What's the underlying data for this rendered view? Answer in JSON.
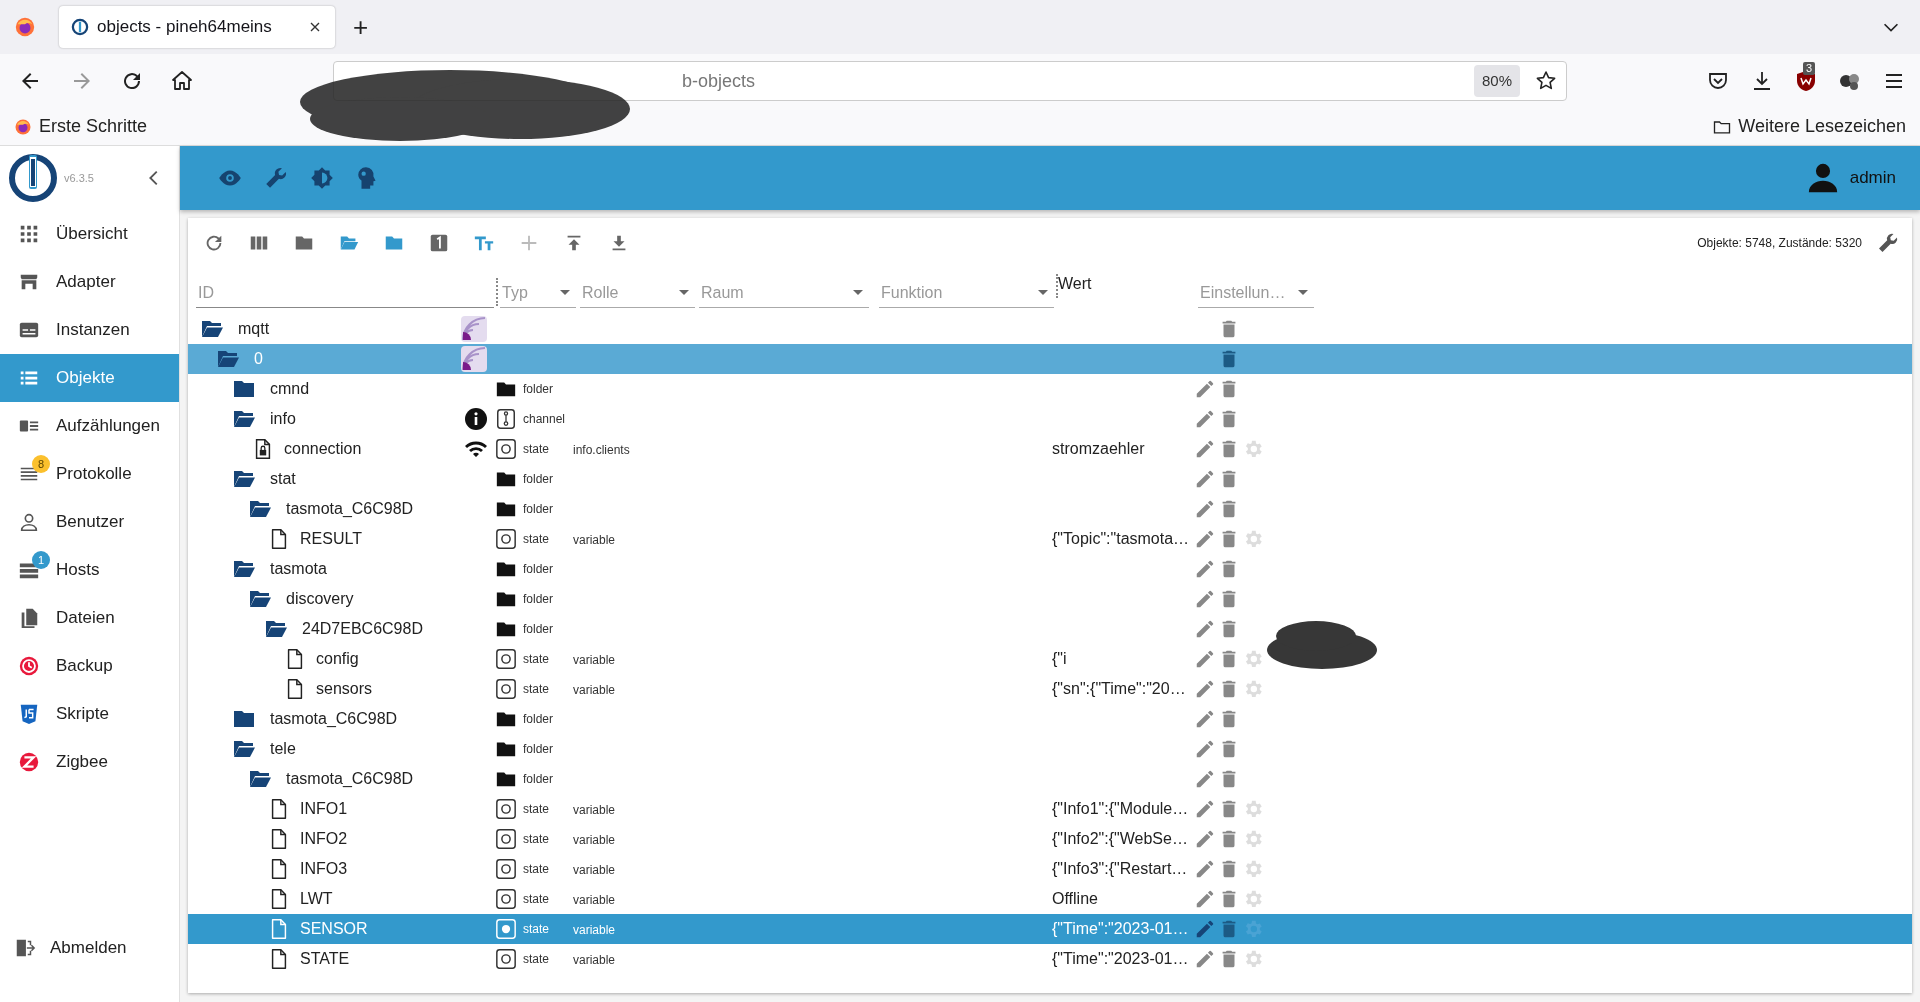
{
  "browser": {
    "tab_title": "objects - pineh64meins",
    "new_tab": "+",
    "url_visible": "b-objects",
    "zoom": "80%",
    "extension_badge": "3",
    "bookmarks": [
      "Erste Schritte"
    ],
    "other_bookmarks": "Weitere Lesezeichen"
  },
  "app": {
    "version": "v6.3.5",
    "user": "admin"
  },
  "sidebar": {
    "items": [
      {
        "label": "Übersicht",
        "selected": false
      },
      {
        "label": "Adapter",
        "selected": false
      },
      {
        "label": "Instanzen",
        "selected": false
      },
      {
        "label": "Objekte",
        "selected": true
      },
      {
        "label": "Aufzählungen",
        "selected": false
      },
      {
        "label": "Protokolle",
        "selected": false,
        "badge": "8",
        "color": "#fbc02d"
      },
      {
        "label": "Benutzer",
        "selected": false
      },
      {
        "label": "Hosts",
        "selected": false,
        "badge": "1",
        "color": "#3399cc"
      },
      {
        "label": "Dateien",
        "selected": false
      },
      {
        "label": "Backup",
        "selected": false
      },
      {
        "label": "Skripte",
        "selected": false
      },
      {
        "label": "Zigbee",
        "selected": false
      }
    ],
    "logout": "Abmelden"
  },
  "objects": {
    "stats": "Objekte: 5748, Zustände: 5320",
    "filters": {
      "id_placeholder": "ID",
      "typ": "Typ",
      "rolle": "Rolle",
      "raum": "Raum",
      "funktion": "Funktion",
      "wert": "Wert",
      "einstellungen": "Einstellun…"
    },
    "tree": [
      {
        "name": "mqtt",
        "kind": "adapter",
        "expanded": true,
        "selected": false,
        "highlighted": false,
        "children": [
          {
            "name": "0",
            "kind": "adapter",
            "expanded": true,
            "selected": false,
            "highlighted": true,
            "children": [
              {
                "name": "cmnd",
                "kind": "folder",
                "expanded": false,
                "type": "folder",
                "selected": false,
                "highlighted": false
              },
              {
                "name": "info",
                "kind": "channel",
                "expanded": true,
                "type": "channel",
                "selected": false,
                "highlighted": false,
                "children": [
                  {
                    "name": "connection",
                    "kind": "connection",
                    "type": "state",
                    "role": "info.clients",
                    "value": "stromzaehler",
                    "selected": false,
                    "highlighted": false
                  }
                ]
              },
              {
                "name": "stat",
                "kind": "folder",
                "expanded": true,
                "type": "folder",
                "selected": false,
                "highlighted": false,
                "children": [
                  {
                    "name": "tasmota_C6C98D",
                    "kind": "folder",
                    "expanded": true,
                    "type": "folder",
                    "selected": false,
                    "highlighted": false,
                    "children": [
                      {
                        "name": "RESULT",
                        "kind": "state",
                        "type": "state",
                        "role": "variable",
                        "value": "{\"Topic\":\"tasmota…",
                        "selected": false,
                        "highlighted": false
                      }
                    ]
                  }
                ]
              },
              {
                "name": "tasmota",
                "kind": "folder",
                "expanded": true,
                "type": "folder",
                "selected": false,
                "highlighted": false,
                "children": [
                  {
                    "name": "discovery",
                    "kind": "folder",
                    "expanded": true,
                    "type": "folder",
                    "selected": false,
                    "highlighted": false,
                    "children": [
                      {
                        "name": "24D7EBC6C98D",
                        "kind": "folder",
                        "expanded": true,
                        "type": "folder",
                        "selected": false,
                        "highlighted": false,
                        "children": [
                          {
                            "name": "config",
                            "kind": "state",
                            "type": "state",
                            "role": "variable",
                            "value": "{\"i",
                            "redacted": true,
                            "selected": false,
                            "highlighted": false
                          },
                          {
                            "name": "sensors",
                            "kind": "state",
                            "type": "state",
                            "role": "variable",
                            "value": "{\"sn\":{\"Time\":\"20…",
                            "selected": false,
                            "highlighted": false
                          }
                        ]
                      }
                    ]
                  }
                ]
              },
              {
                "name": "tasmota_C6C98D",
                "kind": "folder",
                "expanded": false,
                "type": "folder",
                "selected": false,
                "highlighted": false
              },
              {
                "name": "tele",
                "kind": "folder",
                "expanded": true,
                "type": "folder",
                "selected": false,
                "highlighted": false,
                "children": [
                  {
                    "name": "tasmota_C6C98D",
                    "kind": "folder",
                    "expanded": true,
                    "type": "folder",
                    "selected": false,
                    "highlighted": false,
                    "children": [
                      {
                        "name": "INFO1",
                        "kind": "state",
                        "type": "state",
                        "role": "variable",
                        "value": "{\"Info1\":{\"Module…",
                        "selected": false,
                        "highlighted": false
                      },
                      {
                        "name": "INFO2",
                        "kind": "state",
                        "type": "state",
                        "role": "variable",
                        "value": "{\"Info2\":{\"WebSe…",
                        "selected": false,
                        "highlighted": false
                      },
                      {
                        "name": "INFO3",
                        "kind": "state",
                        "type": "state",
                        "role": "variable",
                        "value": "{\"Info3\":{\"Restart…",
                        "selected": false,
                        "highlighted": false
                      },
                      {
                        "name": "LWT",
                        "kind": "state",
                        "type": "state",
                        "role": "variable",
                        "value": "Offline",
                        "selected": false,
                        "highlighted": false
                      },
                      {
                        "name": "SENSOR",
                        "kind": "state",
                        "type": "state",
                        "role": "variable",
                        "value": "{\"Time\":\"2023-01…",
                        "selected": true,
                        "highlighted": false
                      },
                      {
                        "name": "STATE",
                        "kind": "state",
                        "type": "state",
                        "role": "variable",
                        "value": "{\"Time\":\"2023-01…",
                        "selected": false,
                        "highlighted": false
                      }
                    ]
                  }
                ]
              }
            ]
          }
        ]
      }
    ]
  }
}
